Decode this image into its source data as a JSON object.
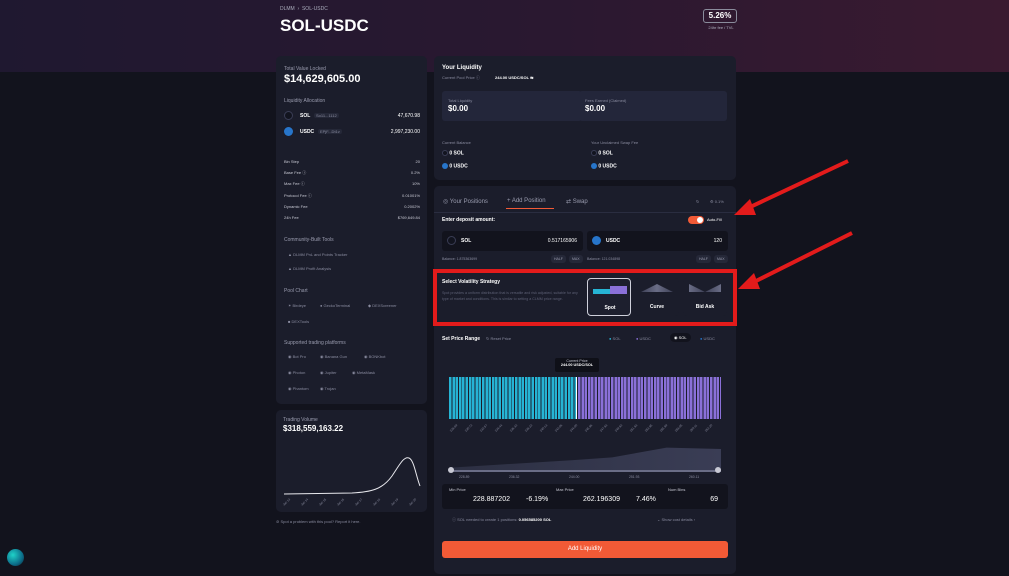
{
  "breadcrumb": {
    "parent": "DLMM",
    "current": "SOL-USDC"
  },
  "pair_title": "SOL-USDC",
  "fee_badge": {
    "value": "5.26%",
    "label": "24hr fee / TVL"
  },
  "tvl": {
    "label": "Total Value Locked",
    "value": "$14,629,605.00"
  },
  "allocation": {
    "title": "Liquidity Allocation",
    "items": [
      {
        "symbol": "SOL",
        "addr": "So11...1112",
        "amount": "47,670.98"
      },
      {
        "symbol": "USDC",
        "addr": "EPjF...Dt1v",
        "amount": "2,997,230.00"
      }
    ]
  },
  "fees": [
    {
      "label": "Bin Step",
      "value": "20"
    },
    {
      "label": "Base Fee",
      "value": "0.2%"
    },
    {
      "label": "Max Fee",
      "value": "10%"
    },
    {
      "label": "Protocol Fee",
      "value": "0.01001%"
    },
    {
      "label": "Dynamic Fee",
      "value": "0.2002%"
    },
    {
      "label": "24h Fee",
      "value": "$769,649.84"
    }
  ],
  "community": {
    "title": "Community-Built Tools",
    "items": [
      "DLMM PnL and Points Tracker",
      "DLMM Profit Analysis"
    ]
  },
  "pool_chart": {
    "title": "Pool Chart",
    "items": [
      "Birdeye",
      "GeckoTerminal",
      "DEXScreener",
      "DEXTools"
    ]
  },
  "platforms": {
    "title": "Supported trading platforms",
    "items": [
      "Bot Pro",
      "Banana Gun",
      "BONKbot",
      "Photon",
      "Jupiter",
      "MetaMask",
      "Phantom",
      "Trojan"
    ]
  },
  "volume": {
    "label": "Trading Volume",
    "value": "$318,559,163.22",
    "dates": [
      "Jan 13",
      "Jan 14",
      "Jan 15",
      "Jan 16",
      "Jan 17",
      "Jan 18",
      "Jan 19",
      "Jan 20"
    ]
  },
  "report_text": "Spot a problem with this pool? Report it here.",
  "your_liquidity": {
    "title": "Your Liquidity",
    "pool_price_label": "Current Pool Price",
    "pool_price": "244.00 USDC/SOL",
    "total_label": "Total Liquidity",
    "total_value": "$0.00",
    "fees_label": "Fees Earned (Claimed)",
    "fees_value": "$0.00",
    "balance_label": "Current Balance",
    "unclaimed_label": "Your Unclaimed Swap Fee",
    "bal_sol": "0 SOL",
    "bal_usdc": "0 USDC",
    "fee_sol": "0 SOL",
    "fee_usdc": "0 USDC"
  },
  "tabs": {
    "positions": "Your Positions",
    "add": "Add Position",
    "swap": "Swap",
    "slippage": "0.1%"
  },
  "deposit": {
    "label": "Enter deposit amount:",
    "autofill": "Auto-Fill",
    "sol_symbol": "SOL",
    "sol_amount": "0.517165906",
    "usdc_symbol": "USDC",
    "usdc_amount": "120",
    "sol_balance": "Balance: 1.875363699",
    "usdc_balance": "Balance: 121.034898",
    "half": "HALF",
    "max": "MAX"
  },
  "strategy": {
    "title": "Select Volatility Strategy",
    "desc": "Spot provides a uniform distribution that is versatile and risk adjusted, suitable for any type of market and conditions. This is similar to setting a CLMM price range.",
    "options": [
      "Spot",
      "Curve",
      "Bid Ask"
    ]
  },
  "price_range": {
    "title": "Set Price Range",
    "reset": "Reset Price",
    "legend_sol": "SOL",
    "legend_usdc": "USDC",
    "toggle_sol": "SOL",
    "toggle_usdc": "USDC",
    "current_label": "Current Price",
    "current_value": "244.00 USDC/SOL",
    "ticks": [
      "228.89",
      "230.72",
      "232.57",
      "234.44",
      "236.32",
      "238.22",
      "240.13",
      "242.06",
      "244.00",
      "245.96",
      "247.93",
      "249.92",
      "251.93",
      "253.95",
      "255.99",
      "258.05",
      "260.11",
      "262.20"
    ],
    "min_label": "Min Price",
    "min_value": "228.887202",
    "min_pct": "-6.19%",
    "max_label": "Max Price",
    "max_value": "262.196309",
    "max_pct": "7.46%",
    "bins_label": "Num Bins",
    "bins_value": "69"
  },
  "rent": {
    "text": "SOL needed to create 1 positions:",
    "value": "0.056585200 SOL",
    "toggle": "Show cost details"
  },
  "add_button": "Add Liquidity",
  "colors": {
    "accent": "#f25a36",
    "teal": "#26b4d4",
    "purple": "#8a70d8",
    "annotation": "#e31b1b"
  }
}
